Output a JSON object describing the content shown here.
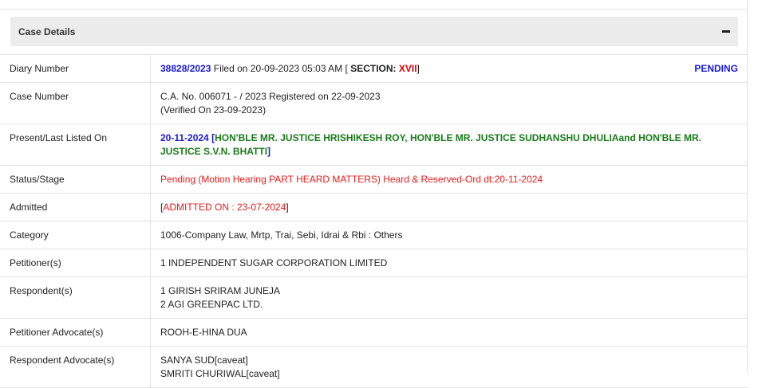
{
  "panel": {
    "title": "Case Details"
  },
  "rows": {
    "diary": {
      "label": "Diary Number",
      "number": "38828/2023",
      "filed": " Filed on 20-09-2023 05:03 AM [ ",
      "section_label": "SECTION: ",
      "section_value": "XVII",
      "close": "]",
      "status": "PENDING"
    },
    "case_number": {
      "label": "Case Number",
      "line1": "C.A. No. 006071 - / 2023 Registered on 22-09-2023",
      "line2": "(Verified On 23-09-2023)"
    },
    "listed": {
      "label": "Present/Last Listed On",
      "date": "20-11-2024 ",
      "sep1": "[",
      "bench": "HON'BLE MR. JUSTICE HRISHIKESH ROY, HON'BLE MR. JUSTICE SUDHANSHU DHULIAand HON'BLE MR. JUSTICE S.V.N. BHATTI",
      "sep2": "]"
    },
    "status": {
      "label": "Status/Stage",
      "value": "Pending (Motion Hearing PART HEARD MATTERS) Heard & Reserved-Ord dt:20-11-2024"
    },
    "admitted": {
      "label": "Admitted",
      "open": "[",
      "value": "ADMITTED ON : 23-07-2024",
      "close": "]"
    },
    "category": {
      "label": "Category",
      "value": "1006-Company Law, Mrtp, Trai, Sebi, Idrai & Rbi : Others"
    },
    "petitioner": {
      "label": "Petitioner(s)",
      "value": "1 INDEPENDENT SUGAR CORPORATION LIMITED"
    },
    "respondent": {
      "label": "Respondent(s)",
      "line1": "1 GIRISH SRIRAM JUNEJA",
      "line2": "2 AGI GREENPAC LTD."
    },
    "pet_adv": {
      "label": "Petitioner Advocate(s)",
      "value": "ROOH-E-HINA DUA"
    },
    "resp_adv": {
      "label": "Respondent Advocate(s)",
      "line1": "SANYA SUD[caveat]",
      "line2": "SMRITI CHURIWAL[caveat]"
    }
  },
  "colors": {
    "link_blue": "#1a1ad0",
    "red": "#e00000",
    "green": "#1a7a1a",
    "panel_bg": "#ececec",
    "border": "#e3e3e3"
  }
}
